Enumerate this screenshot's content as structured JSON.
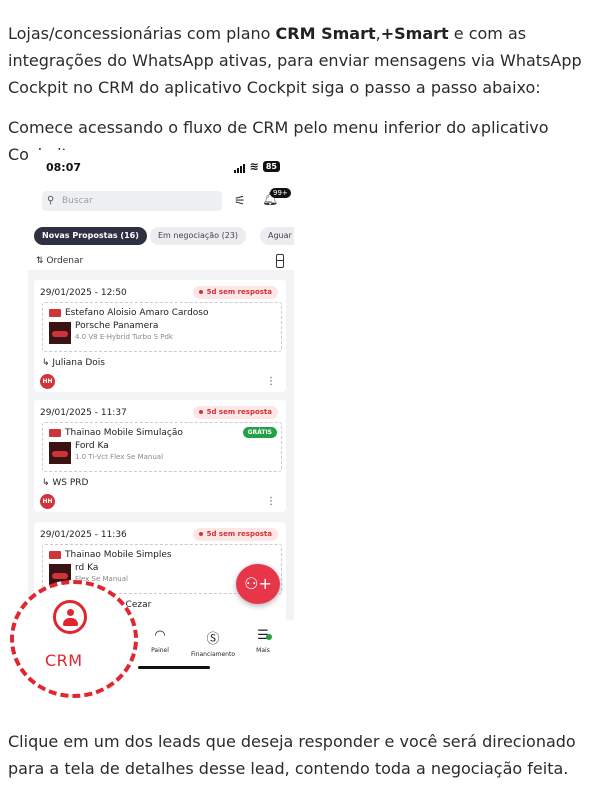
{
  "intro": {
    "pre": "Lojas/concessionárias com plano ",
    "bold": "CRM Smart",
    "mid": ",",
    "bold2": "+Smart",
    "post": " e com as integrações do WhatsApp ativas, para enviar mensagens via WhatsApp Cockpit no CRM do aplicativo Cockpit siga o passo a passo abaixo:"
  },
  "step1": "Comece acessando o fluxo de CRM pelo menu inferior do aplicativo Cockpit:",
  "step2": "Clique em um dos leads que deseja responder e você será direcionado para a tela de detalhes desse lead, contendo toda a negociação feita.",
  "phone": {
    "time": "08:07",
    "battery": "85",
    "search_placeholder": "Buscar",
    "bell_badge": "99+",
    "tabs": [
      "Novas Propostas (16)",
      "Em negociação (23)",
      "Aguar"
    ],
    "order_label": "Ordenar",
    "cards": [
      {
        "date": "29/01/2025 - 12:50",
        "tag": "5d sem resposta",
        "lead": "Estefano Aloisio Amaro Cardoso",
        "model": "Porsche Panamera",
        "version": "4.0 V8 E-Hybrid Turbo S Pdk",
        "seller": "Juliana Dois",
        "gratis": ""
      },
      {
        "date": "29/01/2025 - 11:37",
        "tag": "5d sem resposta",
        "lead": "Thainao Mobile Simulação",
        "model": "Ford Ka",
        "version": "1.0 Ti-Vct Flex Se Manual",
        "seller": "WS PRD",
        "gratis": "GRÁTIS"
      },
      {
        "date": "29/01/2025 - 11:36",
        "tag": "5d sem resposta",
        "lead": "Thainao Mobile Simples",
        "model": "rd Ka",
        "version": "Flex Se Manual",
        "seller": "s Cezar",
        "gratis": ""
      }
    ],
    "avatar_initials": "HH",
    "nav": {
      "painel": "Painel",
      "financiamento": "Financiamento",
      "mais": "Mais"
    },
    "highlight_label": "CRM"
  },
  "colors": {
    "accent": "#e1262f",
    "tag_text": "#d0343b",
    "green": "#24a148",
    "dark_tab": "#2d3142"
  }
}
